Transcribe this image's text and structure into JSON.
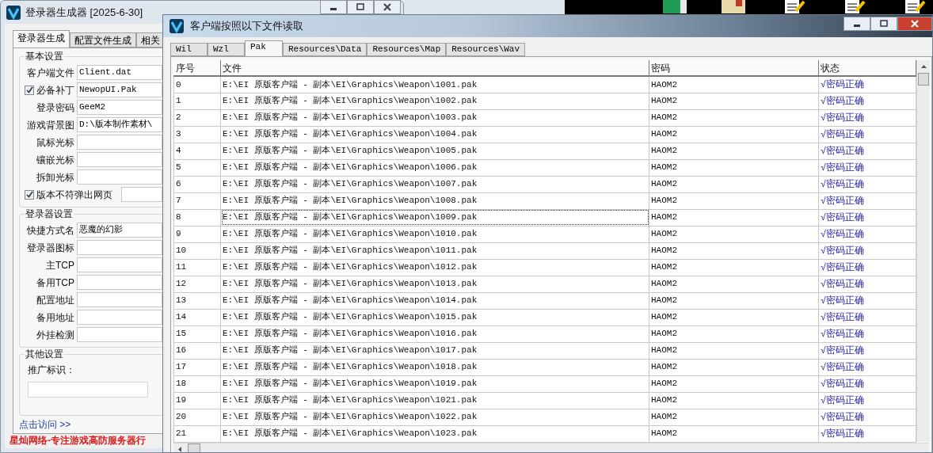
{
  "background_window": {
    "title": "登录器生成器 [2025-6-30]",
    "tabs": [
      {
        "label": "登录器生成",
        "selected": true
      },
      {
        "label": "配置文件生成",
        "selected": false
      },
      {
        "label": "相关",
        "selected": false
      }
    ],
    "groups": [
      {
        "title": "基本设置",
        "rows": [
          {
            "kind": "field",
            "label": "客户端文件",
            "value": "Client.dat"
          },
          {
            "kind": "check",
            "label": "必备补丁",
            "checked": true,
            "value": "NewopUI.Pak"
          },
          {
            "kind": "field",
            "label": "登录密码",
            "value": "GeeM2"
          },
          {
            "kind": "field",
            "label": "游戏背景图",
            "value": "D:\\版本制作素材\\"
          },
          {
            "kind": "field",
            "label": "鼠标光标"
          },
          {
            "kind": "field",
            "label": "镶嵌光标"
          },
          {
            "kind": "field",
            "label": "拆卸光标"
          },
          {
            "kind": "check",
            "label": "版本不符弹出网页",
            "checked": true
          }
        ]
      },
      {
        "title": "登录器设置",
        "rows": [
          {
            "kind": "field",
            "label": "快捷方式名",
            "value": "恶魔的幻影"
          },
          {
            "kind": "field",
            "label": "登录器图标"
          },
          {
            "kind": "field",
            "label": "主TCP"
          },
          {
            "kind": "field",
            "label": "备用TCP"
          },
          {
            "kind": "field",
            "label": "配置地址"
          },
          {
            "kind": "field",
            "label": "备用地址"
          },
          {
            "kind": "field",
            "label": "外挂检测"
          }
        ]
      },
      {
        "title": "其他设置",
        "rows": [
          {
            "kind": "stacked",
            "label": "推广标识："
          }
        ]
      }
    ],
    "link": "点击访问 >>",
    "banner": "星灿网络-专注游戏高防服务器行"
  },
  "front_window": {
    "title": "客户端按照以下文件读取",
    "tabs": [
      {
        "label": "Wil",
        "selected": false
      },
      {
        "label": "Wzl",
        "selected": false
      },
      {
        "label": "Pak",
        "selected": true
      },
      {
        "label": "Resources\\Data",
        "selected": false
      },
      {
        "label": "Resources\\Map",
        "selected": false
      },
      {
        "label": "Resources\\Wav",
        "selected": false
      }
    ],
    "table": {
      "columns": [
        "序号",
        "文件",
        "密码",
        "状态"
      ],
      "rows": [
        {
          "focused": false,
          "cells": [
            "0",
            "E:\\EI 原版客户端 - 副本\\EI\\Graphics\\Weapon\\1001.pak",
            "HAOM2",
            "√密码正确"
          ]
        },
        {
          "focused": false,
          "cells": [
            "1",
            "E:\\EI 原版客户端 - 副本\\EI\\Graphics\\Weapon\\1002.pak",
            "HAOM2",
            "√密码正确"
          ]
        },
        {
          "focused": false,
          "cells": [
            "2",
            "E:\\EI 原版客户端 - 副本\\EI\\Graphics\\Weapon\\1003.pak",
            "HAOM2",
            "√密码正确"
          ]
        },
        {
          "focused": false,
          "cells": [
            "3",
            "E:\\EI 原版客户端 - 副本\\EI\\Graphics\\Weapon\\1004.pak",
            "HAOM2",
            "√密码正确"
          ]
        },
        {
          "focused": false,
          "cells": [
            "4",
            "E:\\EI 原版客户端 - 副本\\EI\\Graphics\\Weapon\\1005.pak",
            "HAOM2",
            "√密码正确"
          ]
        },
        {
          "focused": false,
          "cells": [
            "5",
            "E:\\EI 原版客户端 - 副本\\EI\\Graphics\\Weapon\\1006.pak",
            "HAOM2",
            "√密码正确"
          ]
        },
        {
          "focused": false,
          "cells": [
            "6",
            "E:\\EI 原版客户端 - 副本\\EI\\Graphics\\Weapon\\1007.pak",
            "HAOM2",
            "√密码正确"
          ]
        },
        {
          "focused": false,
          "cells": [
            "7",
            "E:\\EI 原版客户端 - 副本\\EI\\Graphics\\Weapon\\1008.pak",
            "HAOM2",
            "√密码正确"
          ]
        },
        {
          "focused": true,
          "cells": [
            "8",
            "E:\\EI 原版客户端 - 副本\\EI\\Graphics\\Weapon\\1009.pak",
            "HAOM2",
            "√密码正确"
          ]
        },
        {
          "focused": false,
          "cells": [
            "9",
            "E:\\EI 原版客户端 - 副本\\EI\\Graphics\\Weapon\\1010.pak",
            "HAOM2",
            "√密码正确"
          ]
        },
        {
          "focused": false,
          "cells": [
            "10",
            "E:\\EI 原版客户端 - 副本\\EI\\Graphics\\Weapon\\1011.pak",
            "HAOM2",
            "√密码正确"
          ]
        },
        {
          "focused": false,
          "cells": [
            "11",
            "E:\\EI 原版客户端 - 副本\\EI\\Graphics\\Weapon\\1012.pak",
            "HAOM2",
            "√密码正确"
          ]
        },
        {
          "focused": false,
          "cells": [
            "12",
            "E:\\EI 原版客户端 - 副本\\EI\\Graphics\\Weapon\\1013.pak",
            "HAOM2",
            "√密码正确"
          ]
        },
        {
          "focused": false,
          "cells": [
            "13",
            "E:\\EI 原版客户端 - 副本\\EI\\Graphics\\Weapon\\1014.pak",
            "HAOM2",
            "√密码正确"
          ]
        },
        {
          "focused": false,
          "cells": [
            "14",
            "E:\\EI 原版客户端 - 副本\\EI\\Graphics\\Weapon\\1015.pak",
            "HAOM2",
            "√密码正确"
          ]
        },
        {
          "focused": false,
          "cells": [
            "15",
            "E:\\EI 原版客户端 - 副本\\EI\\Graphics\\Weapon\\1016.pak",
            "HAOM2",
            "√密码正确"
          ]
        },
        {
          "focused": false,
          "cells": [
            "16",
            "E:\\EI 原版客户端 - 副本\\EI\\Graphics\\Weapon\\1017.pak",
            "HAOM2",
            "√密码正确"
          ]
        },
        {
          "focused": false,
          "cells": [
            "17",
            "E:\\EI 原版客户端 - 副本\\EI\\Graphics\\Weapon\\1018.pak",
            "HAOM2",
            "√密码正确"
          ]
        },
        {
          "focused": false,
          "cells": [
            "18",
            "E:\\EI 原版客户端 - 副本\\EI\\Graphics\\Weapon\\1019.pak",
            "HAOM2",
            "√密码正确"
          ]
        },
        {
          "focused": false,
          "cells": [
            "19",
            "E:\\EI 原版客户端 - 副本\\EI\\Graphics\\Weapon\\1021.pak",
            "HAOM2",
            "√密码正确"
          ]
        },
        {
          "focused": false,
          "cells": [
            "20",
            "E:\\EI 原版客户端 - 副本\\EI\\Graphics\\Weapon\\1022.pak",
            "HAOM2",
            "√密码正确"
          ]
        },
        {
          "focused": false,
          "cells": [
            "21",
            "E:\\EI 原版客户端 - 副本\\EI\\Graphics\\Weapon\\1023.pak",
            "HAOM2",
            "√密码正确"
          ]
        }
      ]
    }
  }
}
